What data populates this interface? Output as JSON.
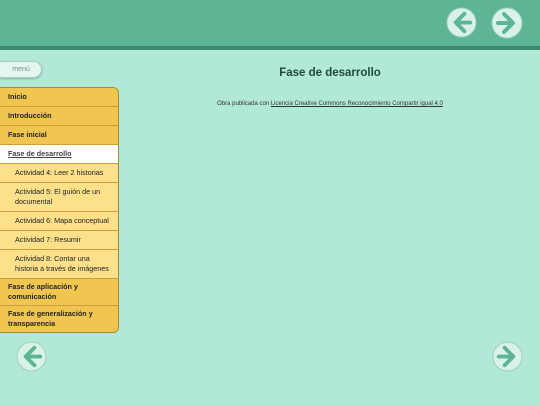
{
  "nav_buttons": {
    "header_prev": "arrow-left-icon",
    "header_next": "arrow-right-icon",
    "footer_prev": "arrow-left-icon",
    "footer_next": "arrow-right-icon"
  },
  "menu": {
    "toggle_label": "menú"
  },
  "sidebar": {
    "items": [
      {
        "label": "Inicio",
        "level": 1
      },
      {
        "label": "Introducción",
        "level": 1
      },
      {
        "label": "Fase inicial",
        "level": 1
      },
      {
        "label": "Fase de desarrollo",
        "level": 1,
        "active": true
      },
      {
        "label": "Actividad 4: Leer 2 historias",
        "level": 2
      },
      {
        "label": "Actividad 5: El guión de un documental",
        "level": 2
      },
      {
        "label": "Actividad 6: Mapa conceptual",
        "level": 2
      },
      {
        "label": "Actividad 7: Resumir",
        "level": 2
      },
      {
        "label": "Actividad 8: Contar una historia a través de imágenes",
        "level": 2
      },
      {
        "label": "Fase de aplicación y comunicación",
        "level": 1
      },
      {
        "label": "Fase de generalización y transparencia",
        "level": 1
      }
    ]
  },
  "main": {
    "title": "Fase de desarrollo",
    "license_prefix": "Obra publicada con ",
    "license_link": "Licencia Creative Commons Reconocimiento Compartir igual 4.0"
  },
  "colors": {
    "header": "#5db594",
    "background": "#b2e8d8",
    "nav_level1": "#f0c650",
    "nav_level2": "#fde08a"
  }
}
